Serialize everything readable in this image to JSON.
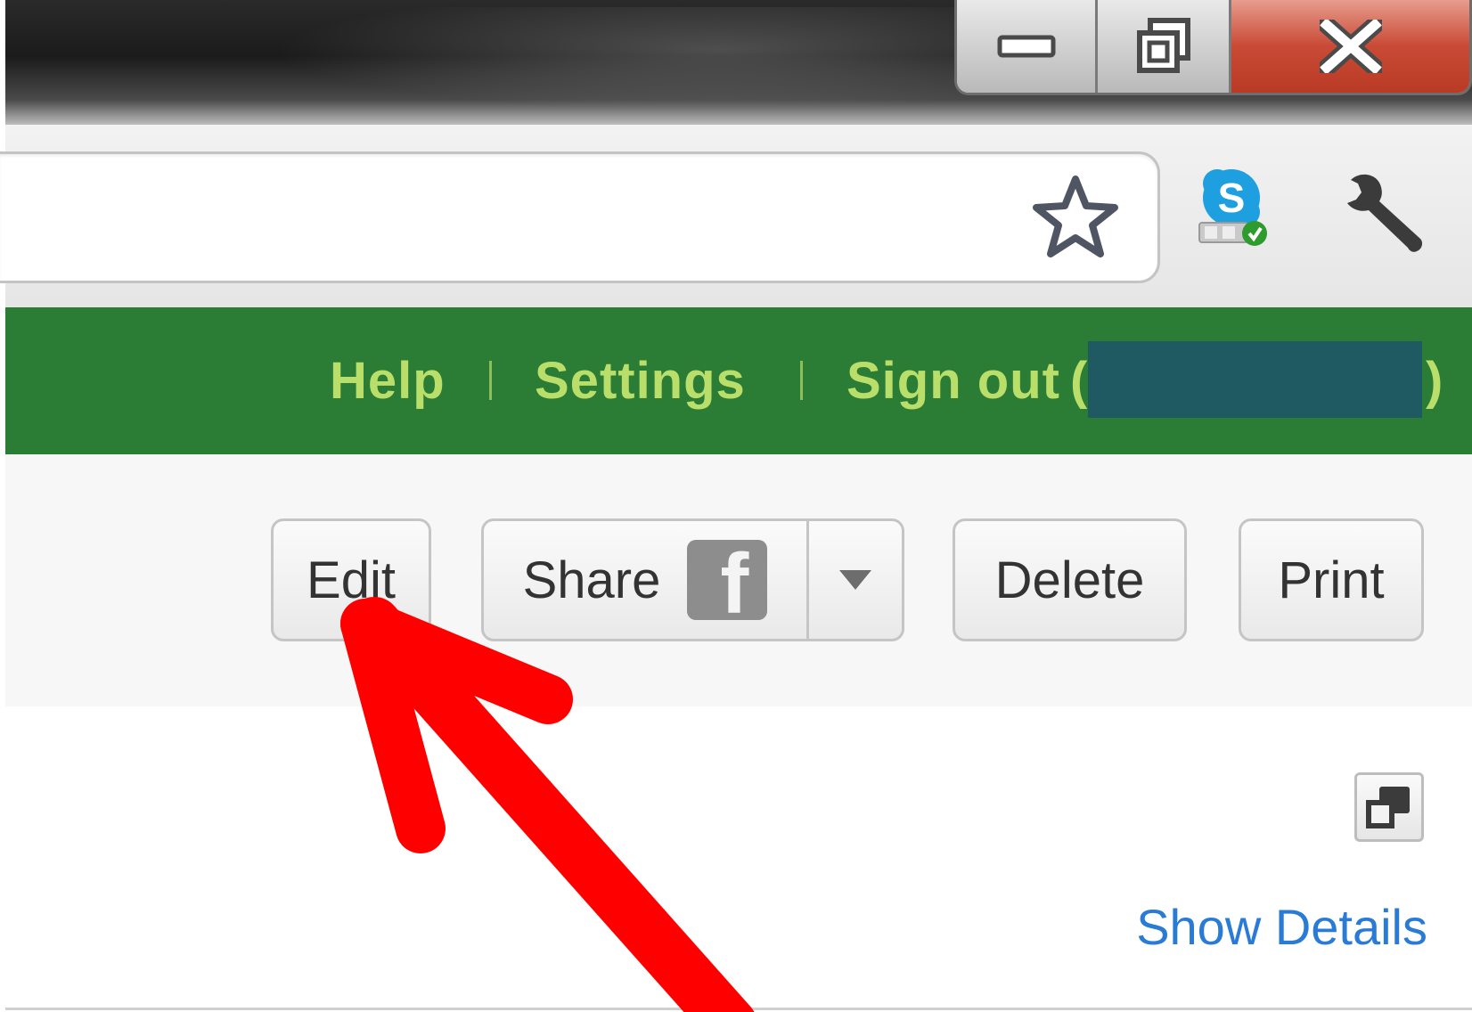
{
  "window_controls": {
    "minimize": "minimize",
    "maximize": "restore",
    "close": "close"
  },
  "omnibox": {
    "value": "",
    "placeholder": ""
  },
  "toolbar_icons": [
    "star-icon",
    "skype-icon",
    "wrench-icon"
  ],
  "nav": {
    "help": "Help",
    "settings": "Settings",
    "sign_out": "Sign out",
    "paren_open": "(",
    "paren_close": ")"
  },
  "actions": {
    "edit": "Edit",
    "share": "Share",
    "share_icon": "f",
    "delete": "Delete",
    "print": "Print"
  },
  "content": {
    "show_details": "Show Details"
  },
  "colors": {
    "nav_bg": "#2b7c35",
    "nav_text": "#b9df6a",
    "link": "#2a7bd6",
    "annotation_arrow": "#ff0000",
    "redaction": "#1f5a63"
  }
}
